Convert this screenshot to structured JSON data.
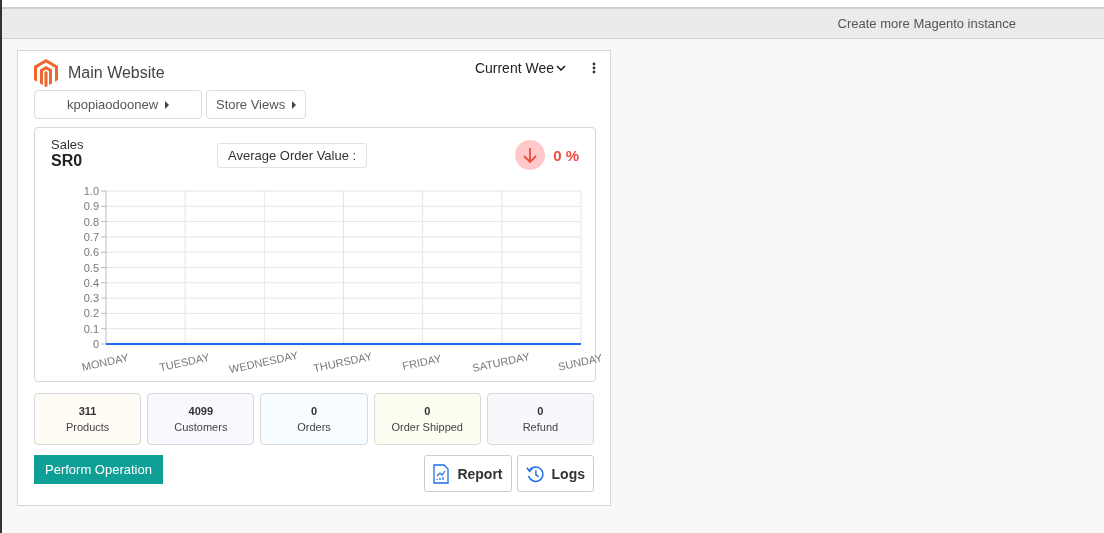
{
  "top_bar": {
    "link": "Create more Magento instance"
  },
  "card": {
    "title": "Main Website",
    "period": "Current Wee",
    "selectors": [
      {
        "label": "kpopiaodoonew"
      },
      {
        "label": "Store Views"
      }
    ],
    "sales": {
      "label": "Sales",
      "value": "SR0",
      "average": "Average Order Value :",
      "trend": {
        "falling": true,
        "value": "0 %"
      },
      "chart_data": {
        "type": "line",
        "categories": [
          "MONDAY",
          "TUESDAY",
          "WEDNESDAY",
          "THURSDAY",
          "FRIDAY",
          "SATURDAY",
          "SUNDAY"
        ],
        "grid": true,
        "series": [
          {
            "color": "#1a6ce8",
            "values": [
              0,
              0,
              0,
              0,
              0,
              0,
              0
            ]
          }
        ],
        "ylim": [
          0,
          1
        ],
        "yticks": [
          {
            "value": 0,
            "label": "0"
          },
          {
            "value": 0.1,
            "label": "0.1"
          },
          {
            "value": 0.2,
            "label": "0.2"
          },
          {
            "value": 0.3,
            "label": "0.3"
          },
          {
            "value": 0.4,
            "label": "0.4"
          },
          {
            "value": 0.5,
            "label": "0.5"
          },
          {
            "value": 0.6,
            "label": "0.6"
          },
          {
            "value": 0.7,
            "label": "0.7"
          },
          {
            "value": 0.8,
            "label": "0.8"
          },
          {
            "value": 0.9,
            "label": "0.9"
          },
          {
            "value": 1,
            "label": "1.0"
          }
        ]
      }
    },
    "stats": [
      {
        "value": "311",
        "label": "Products",
        "color": "#fffcf6"
      },
      {
        "value": "4099",
        "label": "Customers",
        "color": "#f8f8ff"
      },
      {
        "value": "0",
        "label": "Orders",
        "color": "#f6fcff"
      },
      {
        "value": "0",
        "label": "Order Shipped",
        "color": "#fafff2"
      },
      {
        "value": "0",
        "label": "Refund",
        "color": "#f7f8fc"
      }
    ],
    "actions": {
      "primary": "Perform Operation",
      "buttons": [
        {
          "kind": "report",
          "label": "Report"
        },
        {
          "kind": "logs",
          "label": "Logs"
        }
      ]
    }
  }
}
